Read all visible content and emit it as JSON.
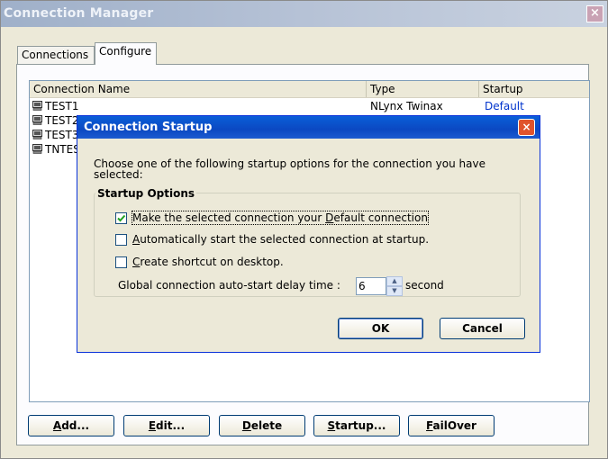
{
  "window": {
    "title": "Connection Manager",
    "close_glyph": "×"
  },
  "tabs": [
    {
      "label": "Connections"
    },
    {
      "label": "Configure"
    }
  ],
  "list": {
    "columns": [
      "Connection Name",
      "Type",
      "Startup"
    ],
    "rows": [
      {
        "name": "TEST1",
        "type": "NLynx Twinax",
        "startup": "Default"
      },
      {
        "name": "TEST2",
        "type": "",
        "startup": ""
      },
      {
        "name": "TEST3",
        "type": "",
        "startup": ""
      },
      {
        "name": "TNTES",
        "type": "",
        "startup": ""
      }
    ]
  },
  "buttons": {
    "add": {
      "mnemonic": "A",
      "rest": "dd..."
    },
    "edit": {
      "mnemonic": "E",
      "rest": "dit..."
    },
    "delete": {
      "mnemonic": "D",
      "rest": "elete"
    },
    "startup": {
      "mnemonic": "S",
      "rest": "tartup..."
    },
    "failover": {
      "mnemonic": "F",
      "rest": "ailOver"
    }
  },
  "dialog": {
    "title": "Connection Startup",
    "close_glyph": "×",
    "message": "Choose one of the following startup options for the connection you have selected:",
    "group_label": "Startup Options",
    "options": [
      {
        "before": "Make the selected connection your ",
        "mnemonic": "D",
        "after": "efault connection",
        "checked": true
      },
      {
        "before": "",
        "mnemonic": "A",
        "after": "utomatically start the selected connection at startup.",
        "checked": false
      },
      {
        "before": "",
        "mnemonic": "C",
        "after": "reate shortcut on desktop.",
        "checked": false
      }
    ],
    "delay_label": "Global connection auto-start delay time :",
    "delay_value": "6",
    "delay_unit": "second",
    "ok_label": "OK",
    "cancel_label": "Cancel"
  },
  "colors": {
    "dialog_title": "#0b48c2",
    "startup_link": "#0033cc",
    "check": "#21a121"
  }
}
